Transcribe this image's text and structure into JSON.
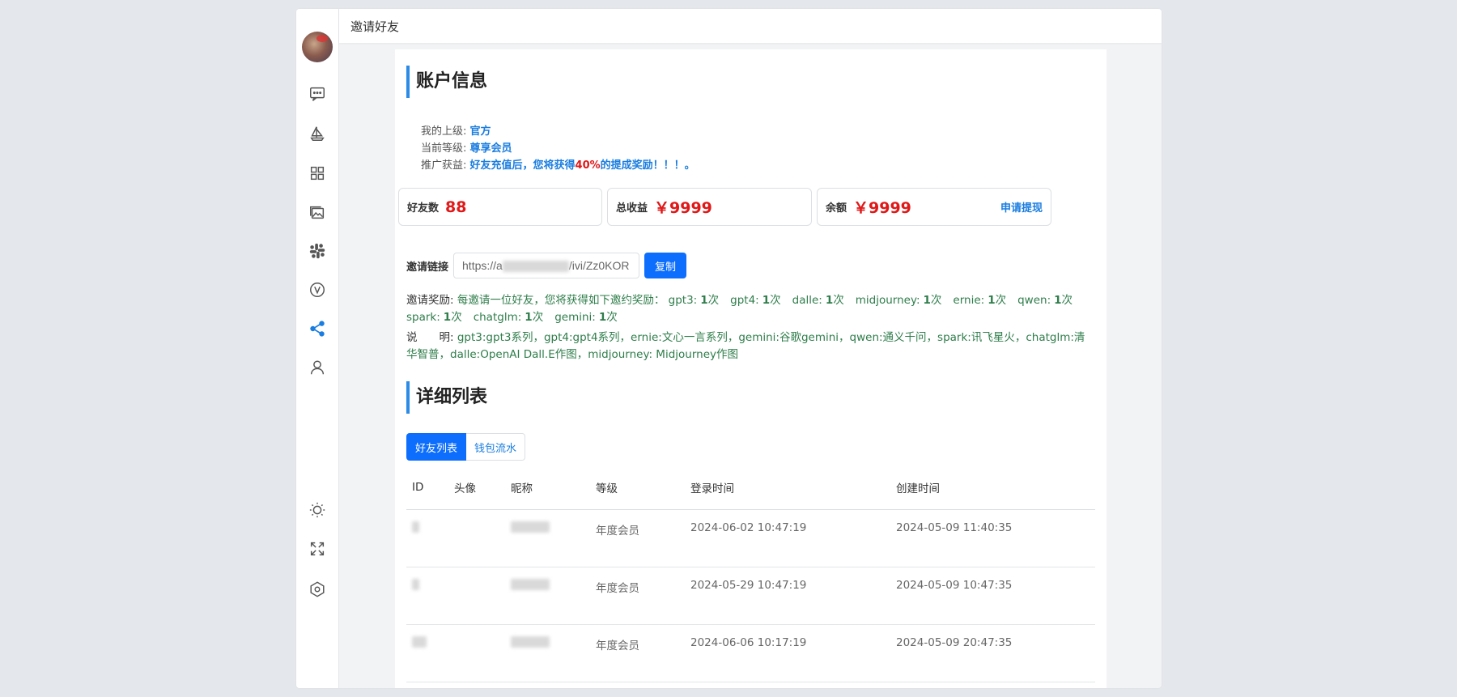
{
  "header": {
    "title": "邀请好友"
  },
  "sidebar": {
    "items": [
      {
        "icon": "chat-icon"
      },
      {
        "icon": "sailboat-icon"
      },
      {
        "icon": "apps-grid-icon"
      },
      {
        "icon": "gallery-icon"
      },
      {
        "icon": "slack-icon"
      },
      {
        "icon": "v-badge-icon"
      },
      {
        "icon": "share-icon",
        "active": true
      },
      {
        "icon": "user-icon"
      }
    ],
    "bottom": [
      {
        "icon": "sun-icon"
      },
      {
        "icon": "fullscreen-icon"
      },
      {
        "icon": "settings-hexagon-icon"
      }
    ],
    "accent": "#1a7de0"
  },
  "account": {
    "title": "账户信息",
    "superior_label": "我的上级:",
    "superior_value": "官方",
    "level_label": "当前等级:",
    "level_value": "尊享会员",
    "promo_label": "推广获益:",
    "promo_prefix": "好友充值后，您将获得",
    "promo_percent": "40%",
    "promo_suffix": "的提成奖励！！！。"
  },
  "stats": {
    "friends_label": "好友数",
    "friends_value": "88",
    "income_label": "总收益",
    "income_value": "￥9999",
    "balance_label": "余额",
    "balance_value": "￥9999",
    "withdraw_label": "申请提现"
  },
  "invite": {
    "label": "邀请链接",
    "link_prefix": "https://a",
    "link_suffix": "/ivi/Zz0KOR",
    "copy_label": "复制"
  },
  "reward": {
    "label": "邀请奖励:",
    "text": "每邀请一位好友，您将获得如下邀约奖励：",
    "items": [
      {
        "name": "gpt3:",
        "count": "1",
        "unit": "次"
      },
      {
        "name": "gpt4:",
        "count": "1",
        "unit": "次"
      },
      {
        "name": "dalle:",
        "count": "1",
        "unit": "次"
      },
      {
        "name": "midjourney:",
        "count": "1",
        "unit": "次"
      },
      {
        "name": "ernie:",
        "count": "1",
        "unit": "次"
      },
      {
        "name": "qwen:",
        "count": "1",
        "unit": "次"
      },
      {
        "name": "spark:",
        "count": "1",
        "unit": "次"
      },
      {
        "name": "chatglm:",
        "count": "1",
        "unit": "次"
      },
      {
        "name": "gemini:",
        "count": "1",
        "unit": "次"
      }
    ]
  },
  "note": {
    "label": "说　　明:",
    "text": "gpt3:gpt3系列，gpt4:gpt4系列，ernie:文心一言系列，gemini:谷歌gemini，qwen:通义千问，spark:讯飞星火，chatglm:清华智普，dalle:OpenAI Dall.E作图，midjourney: Midjourney作图"
  },
  "details": {
    "title": "详细列表",
    "tabs": [
      "好友列表",
      "钱包流水"
    ],
    "columns": [
      "ID",
      "头像",
      "昵称",
      "等级",
      "登录时间",
      "创建时间"
    ],
    "rows": [
      {
        "level": "年度会员",
        "login": "2024-06-02 10:47:19",
        "created": "2024-05-09 11:40:35"
      },
      {
        "level": "年度会员",
        "login": "2024-05-29 10:47:19",
        "created": "2024-05-09 10:47:35"
      },
      {
        "level": "年度会员",
        "login": "2024-06-06 10:17:19",
        "created": "2024-05-09 20:47:35"
      }
    ]
  }
}
